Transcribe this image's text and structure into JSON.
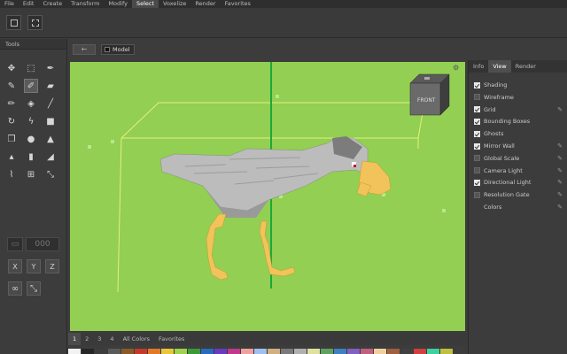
{
  "menubar": {
    "items": [
      "File",
      "Edit",
      "Create",
      "Transform",
      "Modify",
      "Select",
      "Voxelize",
      "Render",
      "Favorites"
    ],
    "active_index": 5
  },
  "tools_panel": {
    "title": "Tools",
    "number_field": "000",
    "axes": [
      "X",
      "Y",
      "Z"
    ]
  },
  "viewport_header": {
    "back_label": "←",
    "model_tab": "Model"
  },
  "viewport": {
    "background_color": "#92cf52",
    "view_cube_label": "FRONT"
  },
  "palette": {
    "tabs": [
      "1",
      "2",
      "3",
      "4",
      "All Colors",
      "Favorites"
    ],
    "active_index": 0,
    "swatches": [
      "#f2f2f2",
      "#262626",
      "#3d3d3d",
      "#5a5a5a",
      "#8a5a2a",
      "#c43a2a",
      "#e07a2a",
      "#e8c83a",
      "#9fd24e",
      "#3a9a3a",
      "#2a6abf",
      "#6a3abf",
      "#bf3a8a",
      "#f0a0a0",
      "#a0c0f0",
      "#d0b080",
      "#7a7a7a",
      "#b0b0b0",
      "#e0e0a0",
      "#60a060",
      "#4080c0",
      "#8060c0",
      "#c06080",
      "#f0d0a0",
      "#a06040",
      "#404040",
      "#d04040",
      "#40d0a0",
      "#c0c040"
    ]
  },
  "right_panel": {
    "tabs": [
      "Info",
      "View",
      "Render"
    ],
    "active_index": 1,
    "options": [
      {
        "label": "Shading",
        "checked": true,
        "editable": false
      },
      {
        "label": "Wireframe",
        "checked": false,
        "editable": false
      },
      {
        "label": "Grid",
        "checked": true,
        "editable": true
      },
      {
        "label": "Bounding Boxes",
        "checked": true,
        "editable": false
      },
      {
        "label": "Ghosts",
        "checked": true,
        "editable": false
      },
      {
        "label": "Mirror Wall",
        "checked": true,
        "editable": true
      },
      {
        "label": "Global Scale",
        "checked": false,
        "editable": true
      },
      {
        "label": "Camera Light",
        "checked": false,
        "editable": true
      },
      {
        "label": "Directional Light",
        "checked": true,
        "editable": true
      },
      {
        "label": "Resolution Gate",
        "checked": false,
        "editable": true
      },
      {
        "label": "Colors",
        "checked": null,
        "editable": true
      }
    ]
  }
}
